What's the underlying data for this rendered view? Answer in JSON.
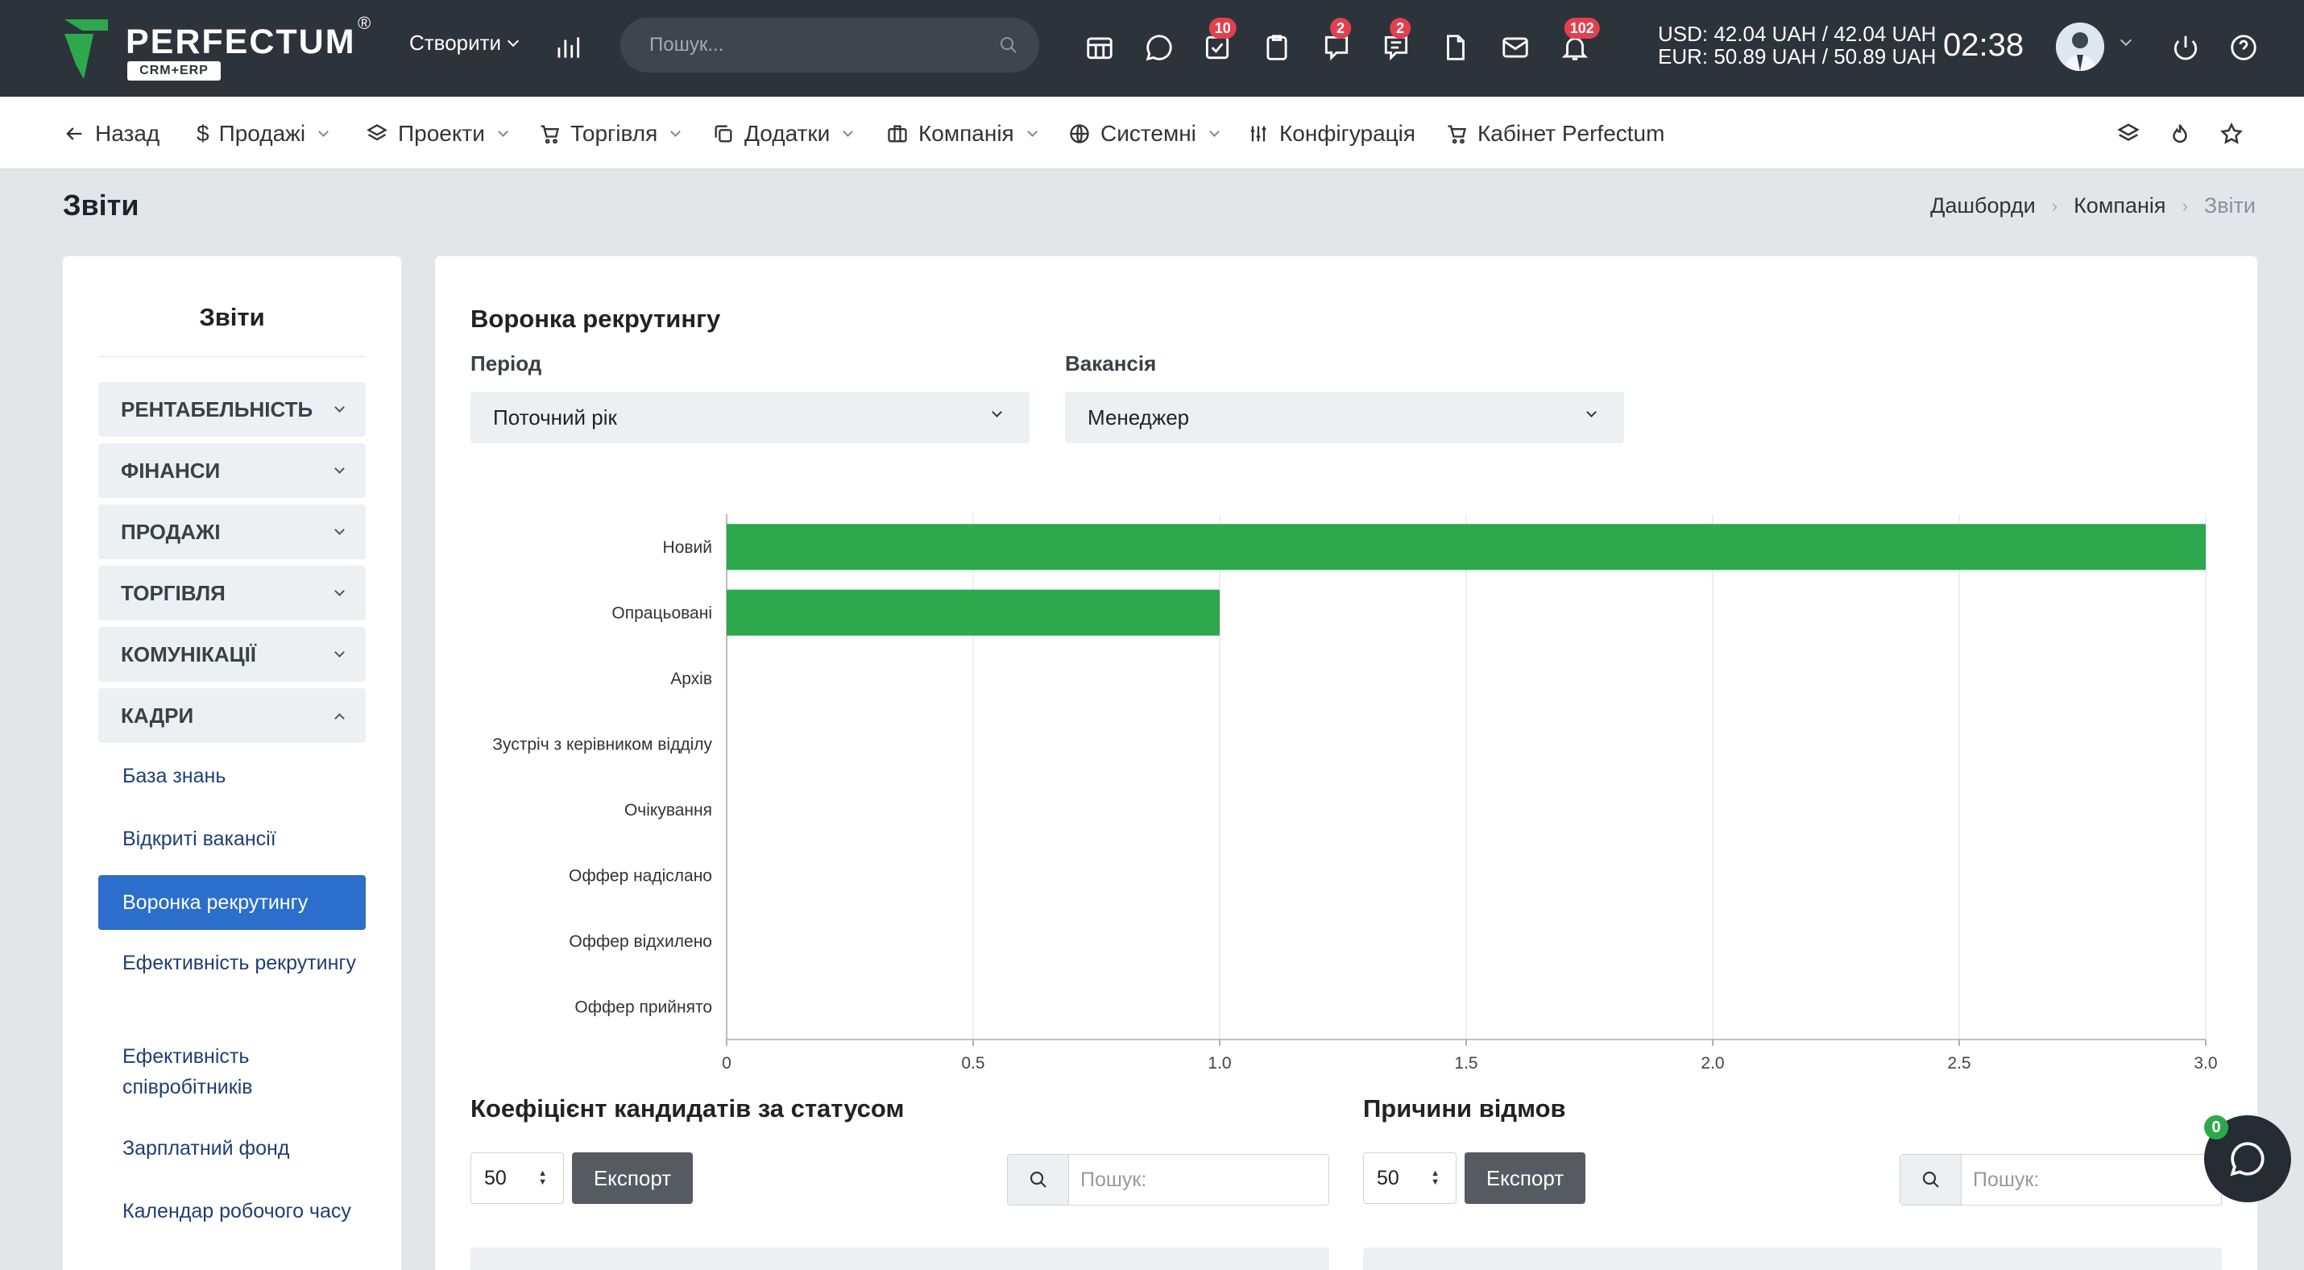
{
  "topbar": {
    "logo": "PERFECTUM",
    "logo_reg": "®",
    "logo_sub": "CRM+ERP",
    "create_label": "Створити",
    "search_placeholder": "Пошук...",
    "badges": {
      "tasks": "10",
      "chat": "2",
      "messages": "2",
      "notifications": "102"
    },
    "currency_usd": "USD: 42.04 UAH / 42.04 UAH",
    "currency_eur": "EUR: 50.89 UAH / 50.89 UAH",
    "time": "02:38"
  },
  "nav": {
    "back": "Назад",
    "sales": "Продажі",
    "projects": "Проекти",
    "trade": "Торгівля",
    "addons": "Додатки",
    "company": "Компанія",
    "system": "Системні",
    "config": "Конфігурація",
    "cabinet": "Кабінет Perfectum"
  },
  "page": {
    "title": "Звіти",
    "breadcrumb": [
      "Дашборди",
      "Компанія",
      "Звіти"
    ]
  },
  "sidebar": {
    "title": "Звіти",
    "sections": [
      "РЕНТАБЕЛЬНІСТЬ",
      "ФІНАНСИ",
      "ПРОДАЖІ",
      "ТОРГІВЛЯ",
      "КОМУНІКАЦІЇ",
      "КАДРИ"
    ],
    "links": [
      "База знань",
      "Відкриті вакансії",
      "Воронка рекрутингу",
      "Ефективність рекрутингу",
      "Ефективність співробітників",
      "Зарплатний фонд",
      "Календар робочого часу"
    ]
  },
  "main": {
    "title": "Воронка рекрутингу",
    "period_label": "Період",
    "period_value": "Поточний рік",
    "vacancy_label": "Вакансія",
    "vacancy_value": "Менеджер",
    "left_table": {
      "title": "Коефіцієнт кандидатів за статусом",
      "length": "50",
      "export": "Експорт",
      "search_placeholder": "Пошук:"
    },
    "right_table": {
      "title": "Причини відмов",
      "length": "50",
      "export": "Експорт",
      "search_placeholder": "Пошук:"
    }
  },
  "chat_badge": "0",
  "chart_data": {
    "type": "bar",
    "orientation": "horizontal",
    "categories": [
      "Новий",
      "Опрацьовані",
      "Архів",
      "Зустріч з керівником відділу",
      "Очікування",
      "Оффер надіслано",
      "Оффер відхилено",
      "Оффер прийнято"
    ],
    "values": [
      3,
      1,
      0,
      0,
      0,
      0,
      0,
      0
    ],
    "xlim": [
      0,
      3
    ],
    "ticks": [
      "0",
      "0.5",
      "1.0",
      "1.5",
      "2.0",
      "2.5",
      "3.0"
    ],
    "color": "#2ea84d",
    "grid": true
  }
}
